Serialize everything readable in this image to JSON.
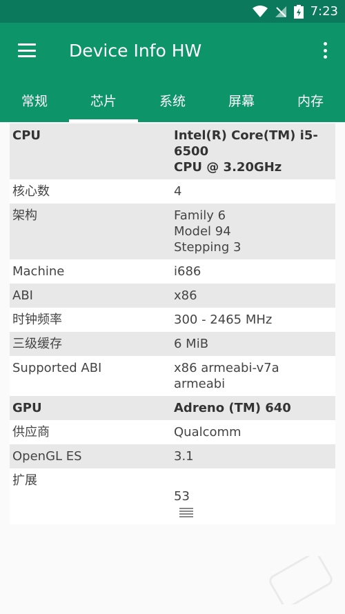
{
  "status_bar": {
    "time": "7:23",
    "icons": [
      "wifi-icon",
      "no-signal-icon",
      "battery-charging-icon"
    ]
  },
  "app_bar": {
    "title": "Device Info HW",
    "menu_icon": "menu-icon",
    "overflow_icon": "more-vert-icon"
  },
  "tabs": [
    {
      "label": "常规"
    },
    {
      "label": "芯片"
    },
    {
      "label": "系统"
    },
    {
      "label": "屏幕"
    },
    {
      "label": "内存"
    }
  ],
  "active_tab": "芯片",
  "rows": [
    {
      "label": "CPU",
      "value": "Intel(R) Core(TM) i5-6500\nCPU @ 3.20GHz"
    },
    {
      "label": "核心数",
      "value": "4"
    },
    {
      "label": "架构",
      "value": "Family 6\nModel 94\nStepping 3"
    },
    {
      "label": "Machine",
      "value": "i686"
    },
    {
      "label": "ABI",
      "value": "x86"
    },
    {
      "label": "时钟频率",
      "value": "300 - 2465 MHz"
    },
    {
      "label": "三级缓存",
      "value": "6 MiB"
    },
    {
      "label": "Supported ABI",
      "value": "x86 armeabi-v7a armeabi"
    },
    {
      "label": "GPU",
      "value": "Adreno (TM) 640"
    },
    {
      "label": "供应商",
      "value": "Qualcomm"
    },
    {
      "label": "OpenGL ES",
      "value": "3.1"
    },
    {
      "label": "扩展",
      "value": "53"
    }
  ],
  "colors": {
    "status_bar": "#0b7a5c",
    "app_bar": "#0d9468",
    "row_shade": "#e8e8e8",
    "row_plain": "#ffffff"
  }
}
